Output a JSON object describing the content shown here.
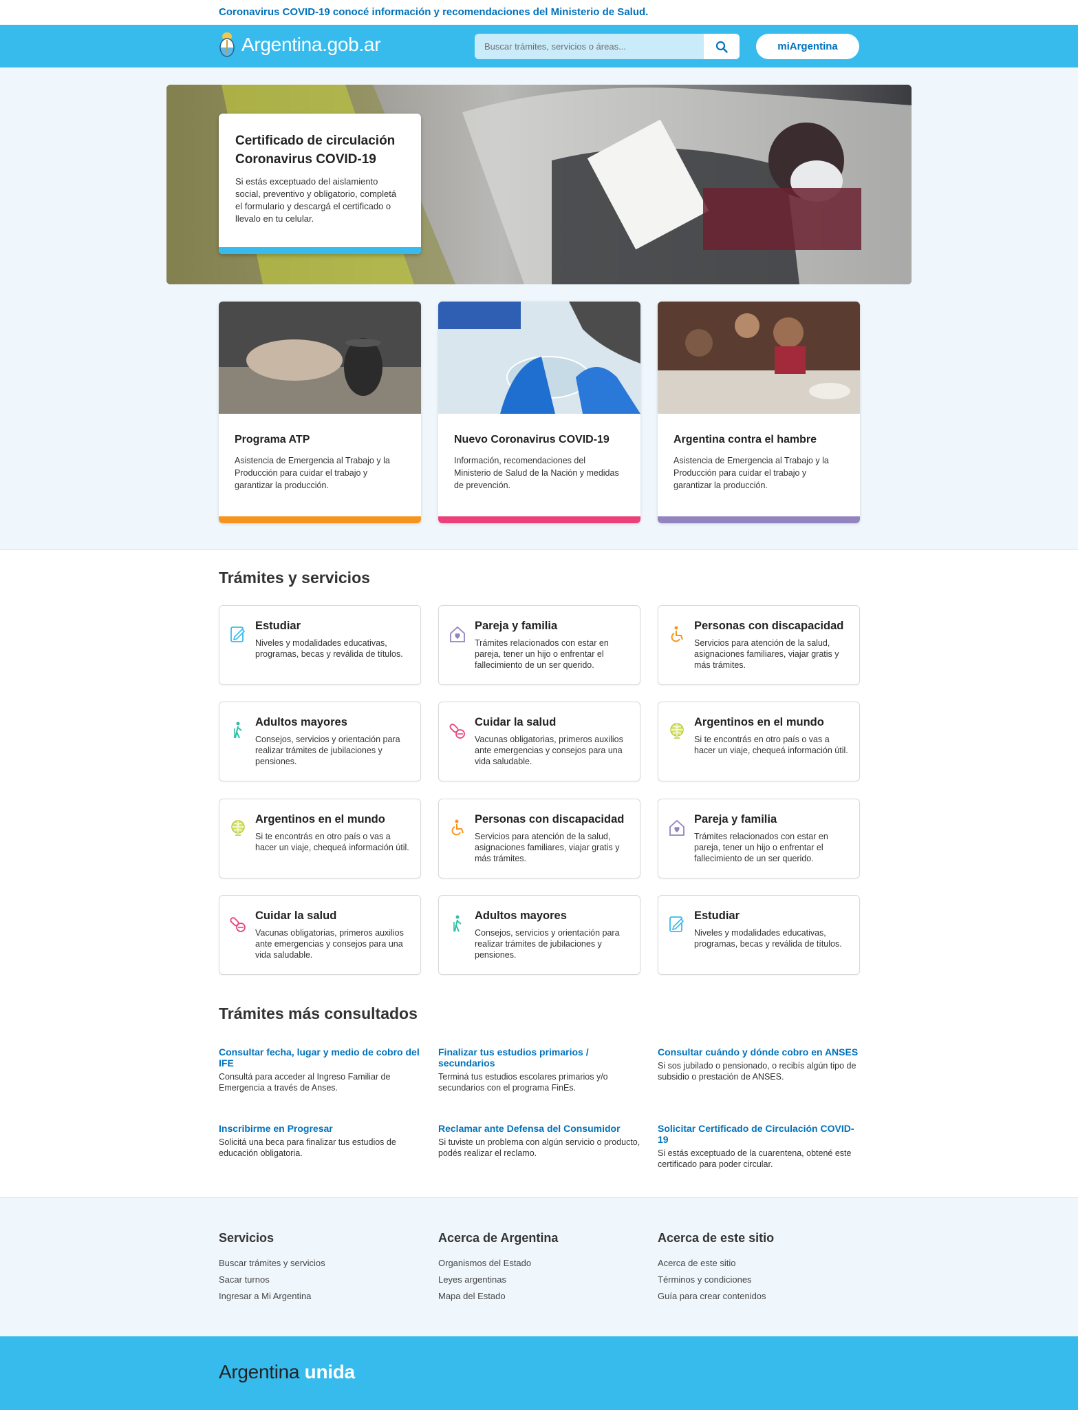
{
  "alert": {
    "text": "Coronavirus COVID-19 conocé información y recomendaciones del Ministerio de Salud."
  },
  "header": {
    "brand": "Argentina.gob.ar",
    "search_placeholder": "Buscar trámites, servicios o áreas...",
    "mi_button": "miArgentina"
  },
  "hero": {
    "title": "Certificado de circulación Coronavirus COVID-19",
    "text": "Si estás exceptuado del aislamiento social, preventivo y obligatorio, completá el formulario y descargá el certificado o llevalo en tu celular."
  },
  "promos": [
    {
      "title": "Programa ATP",
      "text": "Asistencia de Emergencia al Trabajo y la Producción para cuidar el trabajo y garantizar la producción.",
      "color": "#f7941d"
    },
    {
      "title": "Nuevo Coronavirus COVID-19",
      "text": "Información, recomendaciones del Ministerio de Salud de la Nación y medidas de prevención.",
      "color": "#ec407a"
    },
    {
      "title": "Argentina contra el hambre",
      "text": "Asistencia de Emergencia al Trabajo y la Producción para cuidar el trabajo y garantizar la producción.",
      "color": "#9284be"
    }
  ],
  "tramites": {
    "title": "Trámites y servicios",
    "cards": [
      {
        "title": "Estudiar",
        "text": "Niveles y modalidades educativas, programas, becas y reválida de títulos.",
        "icon": "education-icon"
      },
      {
        "title": "Pareja y familia",
        "text": "Trámites relacionados con estar en pareja, tener un hijo o enfrentar el fallecimiento de un ser querido.",
        "icon": "family-house-icon"
      },
      {
        "title": "Personas con discapacidad",
        "text": "Servicios para atención de la salud, asignaciones familiares, viajar gratis y más trámites.",
        "icon": "wheelchair-icon"
      },
      {
        "title": "Adultos mayores",
        "text": "Consejos, servicios y orientación para realizar trámites de jubilaciones y pensiones.",
        "icon": "elderly-icon"
      },
      {
        "title": "Cuidar la salud",
        "text": "Vacunas obligatorias, primeros auxilios ante emergencias y consejos para una vida saludable.",
        "icon": "pills-icon"
      },
      {
        "title": "Argentinos en el mundo",
        "text": "Si te encontrás en otro país o vas a hacer un viaje, chequeá información útil.",
        "icon": "globe-icon"
      },
      {
        "title": "Argentinos en el mundo",
        "text": "Si te encontrás en otro país o vas a hacer un viaje, chequeá información útil.",
        "icon": "globe-icon"
      },
      {
        "title": "Personas con discapacidad",
        "text": "Servicios para atención de la salud, asignaciones familiares, viajar gratis y más trámites.",
        "icon": "wheelchair-icon"
      },
      {
        "title": "Pareja y familia",
        "text": "Trámites relacionados con estar en pareja, tener un hijo o enfrentar el fallecimiento de un ser querido.",
        "icon": "family-house-icon"
      },
      {
        "title": "Cuidar la salud",
        "text": "Vacunas obligatorias, primeros auxilios ante emergencias y consejos para una vida saludable.",
        "icon": "pills-icon"
      },
      {
        "title": "Adultos mayores",
        "text": "Consejos, servicios y orientación para realizar trámites de jubilaciones y pensiones.",
        "icon": "elderly-icon"
      },
      {
        "title": "Estudiar",
        "text": "Niveles y modalidades educativas, programas, becas y reválida de títulos.",
        "icon": "education-icon"
      }
    ]
  },
  "consultados": {
    "title": "Trámites más consultados",
    "items": [
      {
        "title": "Consultar fecha, lugar y medio de cobro del IFE",
        "text": "Consultá para acceder al Ingreso Familiar de Emergencia a través de Anses."
      },
      {
        "title": "Finalizar tus estudios primarios / secundarios",
        "text": "Terminá tus estudios escolares primarios y/o secundarios con el programa FinEs."
      },
      {
        "title": "Consultar cuándo y dónde cobro en ANSES",
        "text": "Si sos jubilado o pensionado, o recibís algún tipo de subsidio o prestación de ANSES."
      },
      {
        "title": "Inscribirme en Progresar",
        "text": "Solicitá una beca para finalizar tus estudios de educación obligatoria."
      },
      {
        "title": "Reclamar ante Defensa del Consumidor",
        "text": "Si tuviste un problema con algún servicio o producto, podés realizar el reclamo."
      },
      {
        "title": "Solicitar Certificado de Circulación COVID-19",
        "text": "Si estás exceptuado de la cuarentena, obtené este certificado para poder circular."
      }
    ]
  },
  "footer": {
    "columns": [
      {
        "title": "Servicios",
        "links": [
          "Buscar trámites y servicios",
          "Sacar turnos",
          "Ingresar a Mi Argentina"
        ]
      },
      {
        "title": "Acerca de Argentina",
        "links": [
          "Organismos del Estado",
          "Leyes argentinas",
          "Mapa del Estado"
        ]
      },
      {
        "title": "Acerca de este sitio",
        "links": [
          "Acerca de este sitio",
          "Términos y condiciones",
          "Guía para crear contenidos"
        ]
      }
    ],
    "logo_main": "Argentina",
    "logo_accent": "unida"
  }
}
